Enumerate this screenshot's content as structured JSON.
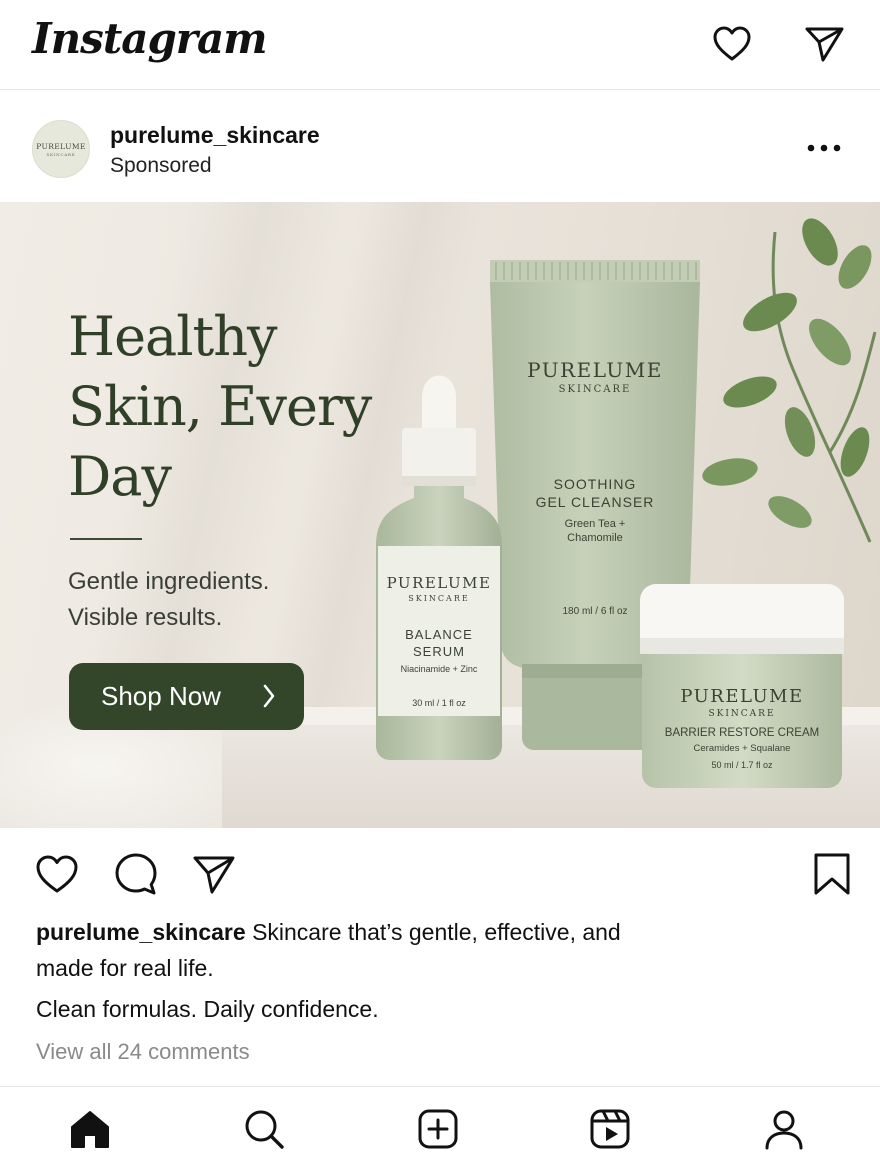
{
  "app": {
    "title": "Instagram"
  },
  "header": {
    "icons": [
      "heart-icon",
      "send-icon"
    ]
  },
  "post": {
    "username": "purelume_skincare",
    "label": "Sponsored",
    "avatar": {
      "line1": "PURELUME",
      "line2": "SKINCARE"
    }
  },
  "ad": {
    "headline": "Healthy\nSkin, Every\nDay",
    "subtext": "Gentle ingredients.\nVisible results.",
    "cta": "Shop Now",
    "colors": {
      "brand_green": "#33462a",
      "sage": "#b9c6ad"
    },
    "products": {
      "tube": {
        "brand": "PURELUME",
        "sub": "SKINCARE",
        "name1": "SOOTHING",
        "name2": "GEL CLEANSER",
        "desc1": "Green Tea +",
        "desc2": "Chamomile",
        "size": "180 ml / 6 fl oz"
      },
      "serum": {
        "brand": "PURELUME",
        "sub": "SKINCARE",
        "name1": "BALANCE",
        "name2": "SERUM",
        "desc": "Niacinamide + Zinc",
        "size": "30 ml / 1 fl oz"
      },
      "jar": {
        "brand": "PURELUME",
        "sub": "SKINCARE",
        "name": "BARRIER RESTORE CREAM",
        "desc": "Ceramides + Squalane",
        "size": "50 ml / 1.7 fl oz"
      }
    }
  },
  "actions": {
    "icons": [
      "heart-icon",
      "comment-icon",
      "share-icon",
      "bookmark-icon"
    ]
  },
  "caption": {
    "username": "purelume_skincare",
    "text": "Skincare that’s gentle, effective, and made for real life.",
    "line2": "Clean formulas. Daily confidence.",
    "comments": "View all 24 comments"
  },
  "nav": {
    "icons": [
      "home-icon",
      "search-icon",
      "create-icon",
      "reels-icon",
      "profile-icon"
    ]
  }
}
